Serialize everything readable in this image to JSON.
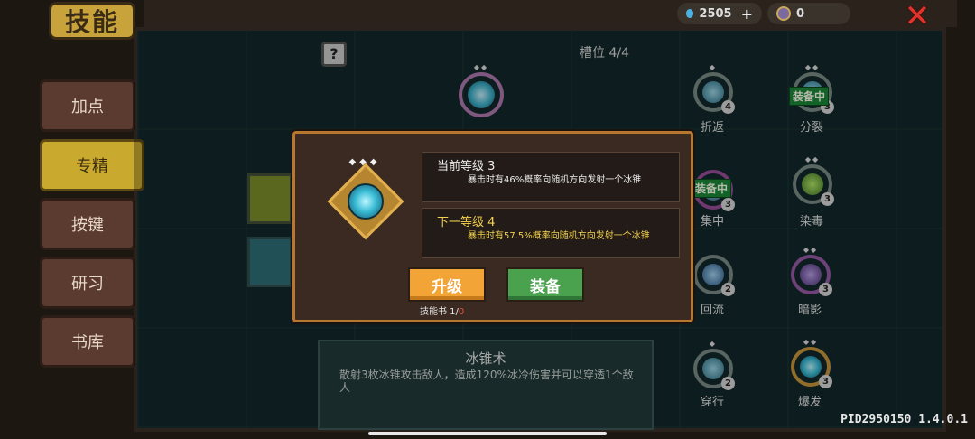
{
  "header": {
    "title": "技能",
    "gems": "2505",
    "gems_plus": "+",
    "tokens": "0"
  },
  "sidebar": {
    "items": [
      {
        "label": "加点",
        "active": false
      },
      {
        "label": "专精",
        "active": true
      },
      {
        "label": "按键",
        "active": false
      },
      {
        "label": "研习",
        "active": false
      },
      {
        "label": "书库",
        "active": false
      }
    ]
  },
  "main": {
    "slots_label": "槽位 4/4",
    "help": "?",
    "skills": [
      {
        "name": "折返",
        "level": "4"
      },
      {
        "name": "分裂",
        "level": "3",
        "badge": "装备中"
      },
      {
        "name": "集中",
        "level": "3",
        "badge": "装备中"
      },
      {
        "name": "染毒",
        "level": "3"
      },
      {
        "name": "回流",
        "level": "2"
      },
      {
        "name": "暗影",
        "level": "3"
      },
      {
        "name": "穿行",
        "level": "2"
      },
      {
        "name": "爆发",
        "level": "3"
      }
    ],
    "description": {
      "title": "冰锥术",
      "text": "散射3枚冰锥攻击敌人，造成120%冰冷伤害并可以穿透1个敌人"
    }
  },
  "modal": {
    "current": {
      "header": "当前等级 3",
      "text": "暴击时有46%概率向随机方向发射一个冰锥"
    },
    "next": {
      "header": "下一等级 4",
      "text": "暴击时有57.5%概率向随机方向发射一个冰锥"
    },
    "upgrade_label": "升级",
    "equip_label": "装备",
    "book_label": "技能书 1/",
    "book_count": "0"
  },
  "footer": {
    "pid": "PID2950150 1.4.0.1"
  },
  "colors": {
    "accent_gold": "#c9aa2e",
    "upgrade_button": "#f3a437",
    "equip_button": "#4aa24f",
    "close_red": "#e2342c"
  }
}
